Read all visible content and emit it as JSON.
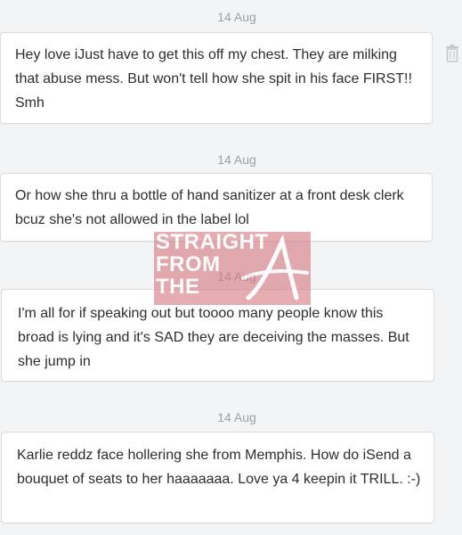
{
  "messages": [
    {
      "date": "14 Aug",
      "text": "Hey love iJust have to get this off my chest. They are milking that abuse mess. But won't tell how she spit in his face FIRST!! Smh"
    },
    {
      "date": "14 Aug",
      "text": "Or how she thru a bottle of hand sanitizer at a front desk clerk bcuz she's not allowed in the label lol"
    },
    {
      "date": "14 Aug",
      "text": "I'm all for if speaking out but toooo many people know this broad is lying and it's SAD they are deceiving the masses. But she jump in"
    },
    {
      "date": "14 Aug",
      "text": "Karlie reddz face hollering she from Memphis. How do iSend a bouquet of seats to her haaaaaaa. Love ya 4 keepin it TRILL. :-)"
    }
  ],
  "icons": {
    "delete": "trash-icon"
  },
  "watermark": {
    "lines": [
      "STRAIGHT",
      "FROM",
      "THE"
    ],
    "logo_letter": "A"
  },
  "colors": {
    "background": "#f3f4f6",
    "bubble": "#ffffff",
    "date_text": "#9aa0a6",
    "message_text": "#2d2d2d",
    "watermark": "#d67a82"
  }
}
